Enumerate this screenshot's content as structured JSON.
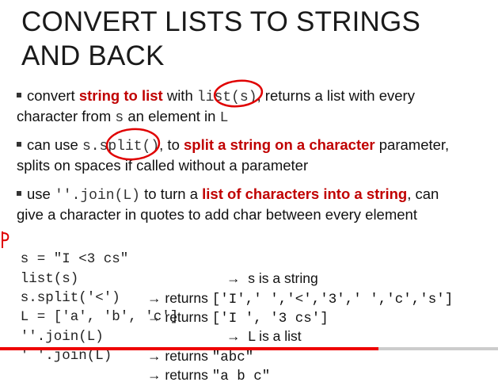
{
  "slide": {
    "title_line1": "CONVERT LISTS TO STRINGS",
    "title_line2": "AND BACK"
  },
  "bullets": [
    {
      "p1": "convert ",
      "red": "string to list",
      "p2": " with ",
      "code": "list",
      "p3": "(s)",
      "p4": ", returns a list with every",
      "p5": "character from ",
      "code2": "s",
      "p6": " an element in ",
      "code3": "L"
    },
    {
      "p1": "can use ",
      "code": "s.split()",
      "p2": ", to ",
      "red": "split a string on a character",
      "p3": " parameter,",
      "p4": "splits on spaces if called without a parameter"
    },
    {
      "p1": "use ",
      "code": "''.join(L)",
      "p2": " to turn a ",
      "red": "list of characters into a string",
      "p3": ", can",
      "p4": "give a character in quotes to add char between every element"
    }
  ],
  "code_rows": [
    {
      "code": "s = \"I <3 cs\"",
      "arrow": "→",
      "desc": "s is a string"
    },
    {
      "code": "list(s)",
      "arrow": "→",
      "desc_prefix": "returns ",
      "desc_mono": "['I',' ','<','3',' ','c','s']"
    },
    {
      "code": "s.split('<')",
      "arrow": "→",
      "desc_prefix": "returns ",
      "desc_mono": "['I ', '3 cs']"
    },
    {
      "code": "L = ['a', 'b', 'c']",
      "arrow": "→",
      "desc": "L is a list"
    },
    {
      "code": "''.join(L)",
      "arrow": "→",
      "desc_prefix": "returns ",
      "desc_mono": "\"abc\""
    },
    {
      "code": "' '.join(L)",
      "arrow": "→",
      "desc_prefix": "returns ",
      "desc_mono": "\"a b c\""
    }
  ],
  "video": {
    "progress": 0.76
  },
  "colors": {
    "accent": "#c00000",
    "annotation": "#e00000"
  }
}
